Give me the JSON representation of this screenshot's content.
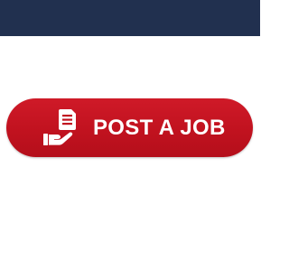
{
  "header": {
    "color": "#21304f"
  },
  "cta": {
    "label": "POST A JOB",
    "icon": "hand-holding-document-icon",
    "color": "#c1121f"
  }
}
